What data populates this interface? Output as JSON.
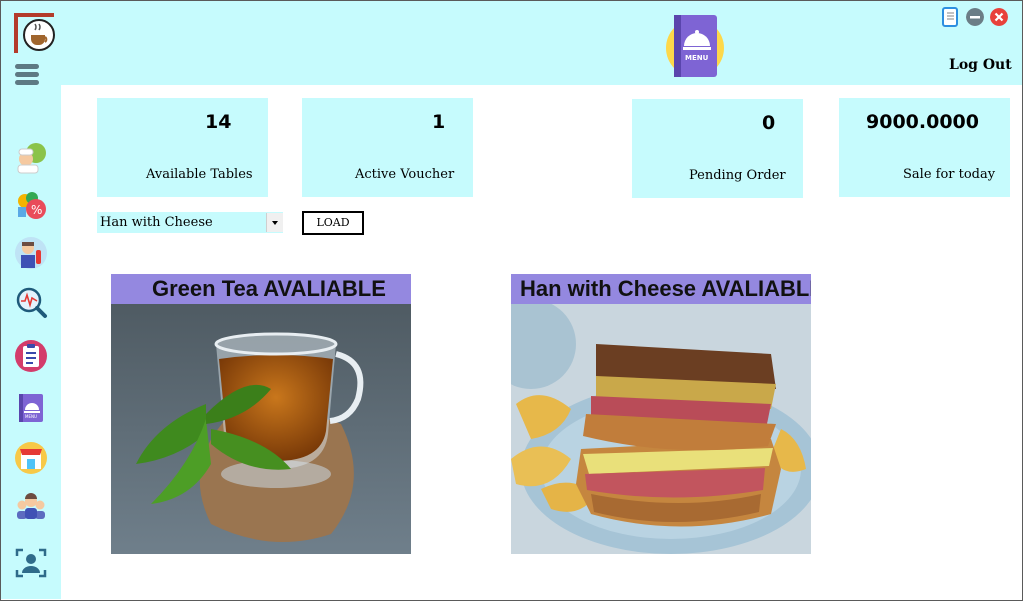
{
  "app": {
    "logout_label": "Log Out"
  },
  "sidebar": {
    "items": [
      {
        "icon": "chef-icon"
      },
      {
        "icon": "discount-icon"
      },
      {
        "icon": "waiter-icon"
      },
      {
        "icon": "analytics-icon"
      },
      {
        "icon": "order-clipboard-icon"
      },
      {
        "icon": "menu-book-icon"
      },
      {
        "icon": "shop-icon"
      },
      {
        "icon": "users-icon"
      },
      {
        "icon": "user-profile-icon"
      }
    ]
  },
  "stats": {
    "available_tables": {
      "value": "14",
      "label": "Available Tables"
    },
    "active_voucher": {
      "value": "1",
      "label": "Active Voucher"
    },
    "pending_order": {
      "value": "0",
      "label": "Pending Order"
    },
    "sale_today": {
      "value": "9000.0000",
      "label": "Sale for today"
    }
  },
  "controls": {
    "selected_item": "Han with Cheese",
    "load_label": "LOAD"
  },
  "products": [
    {
      "banner": "Green Tea AVALIABLE",
      "image": "green-tea-photo"
    },
    {
      "banner": "Han with Cheese AVALIABLE",
      "image": "ham-cheese-sandwich-photo"
    }
  ],
  "colors": {
    "panel": "#c6fbfd",
    "banner": "#9488e0",
    "close": "#e8413b",
    "minimize": "#6b7d86"
  }
}
